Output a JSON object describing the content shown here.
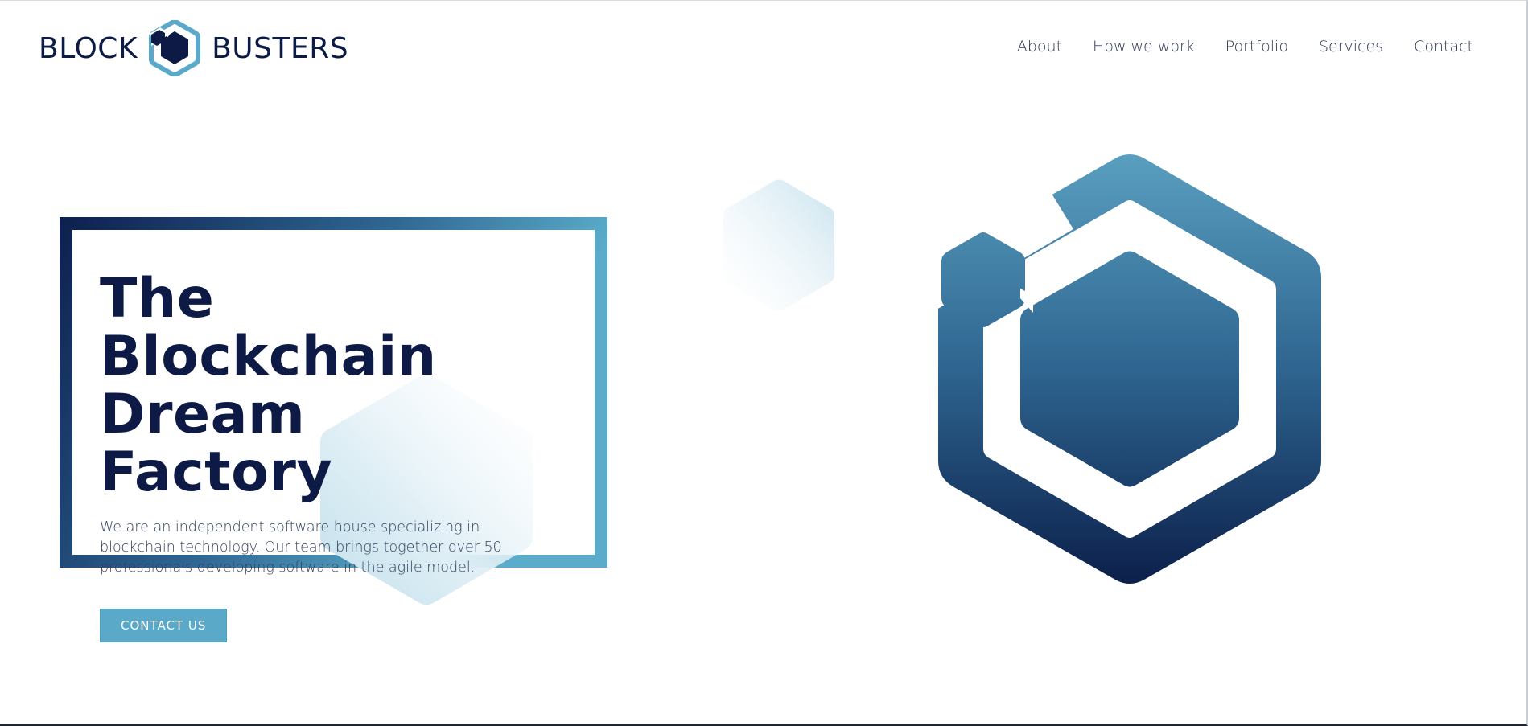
{
  "brand": {
    "word_left": "BLOCK",
    "word_right": "BUSTERS",
    "mark_icon": "hexagon-logo-icon"
  },
  "nav": {
    "items": [
      {
        "label": "About"
      },
      {
        "label": "How we work"
      },
      {
        "label": "Portfolio"
      },
      {
        "label": "Services"
      },
      {
        "label": "Contact"
      }
    ]
  },
  "hero": {
    "title_line1": "The Blockchain",
    "title_line2": "Dream Factory",
    "text": "We are an independent software house specializing in blockchain technology. Our team brings together over 50 professionals developing software in the agile model.",
    "cta_label": "CONTACT US",
    "illustration_icon": "large-hexagon-logo-icon"
  },
  "colors": {
    "navy": "#0c1a45",
    "accent_blue": "#5aa9c8",
    "gradient_top": "#5a9fc0",
    "gradient_bottom": "#0b1f4a"
  }
}
